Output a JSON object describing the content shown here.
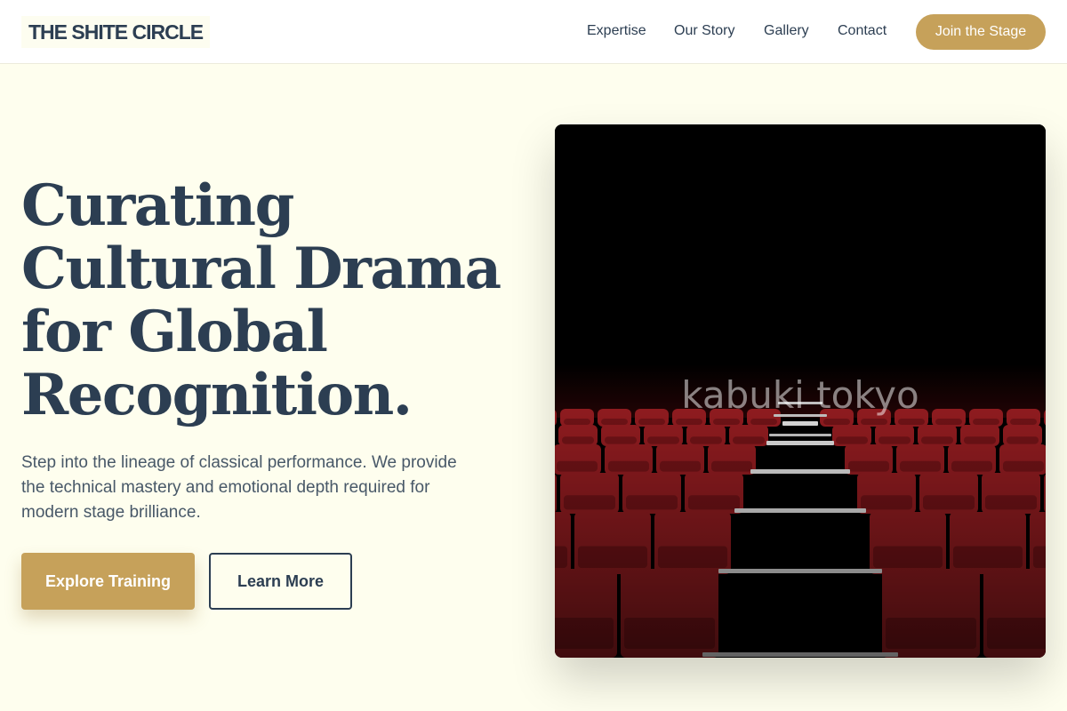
{
  "header": {
    "logo": "THE SHITE CIRCLE",
    "nav": [
      {
        "label": "Expertise"
      },
      {
        "label": "Our Story"
      },
      {
        "label": "Gallery"
      },
      {
        "label": "Contact"
      }
    ],
    "cta_label": "Join the Stage"
  },
  "hero": {
    "title_lines": [
      "Curating",
      "Cultural Drama",
      "for Global",
      "Recognition."
    ],
    "subtitle": "Step into the lineage of classical performance. We provide the technical mastery and emotional depth required for modern stage brilliance.",
    "primary_button": "Explore Training",
    "secondary_button": "Learn More",
    "image_alt": "kabuki tokyo"
  },
  "colors": {
    "background": "#fefeee",
    "navy": "#2c3e52",
    "gold": "#c6a15a",
    "seat_red": "#8e1b1f"
  }
}
